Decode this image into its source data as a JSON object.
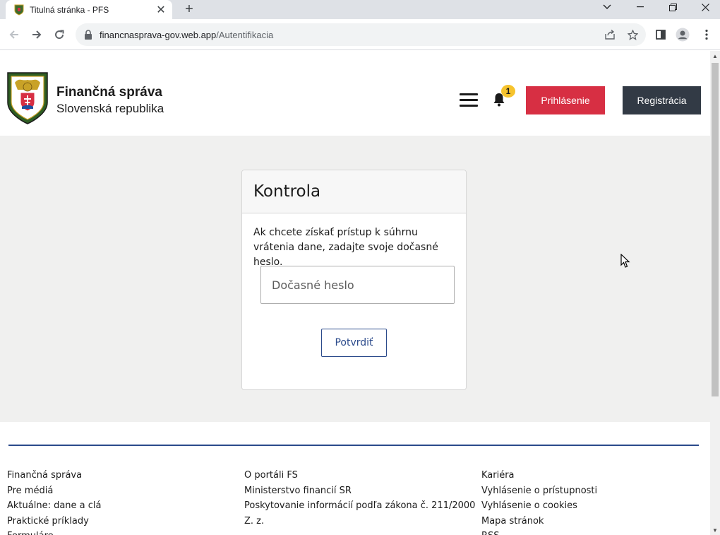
{
  "browser": {
    "tab_title": "Titulná stránka - PFS",
    "url_host": "financnasprava-gov.web.app",
    "url_path": "/Autentifikacia"
  },
  "header": {
    "brand_title": "Finančná správa",
    "brand_subtitle": "Slovenská republika",
    "crest_text": "FINANČNÁ SPRÁVA · SLOVENSKÁ REPUBLIKA",
    "notification_count": "1",
    "login_label": "Prihlásenie",
    "register_label": "Registrácia"
  },
  "card": {
    "title": "Kontrola",
    "description": "Ak chcete získať prístup k súhrnu vrátenia dane, zadajte svoje dočasné heslo.",
    "password_placeholder": "Dočasné heslo",
    "confirm_label": "Potvrdiť"
  },
  "footer": {
    "col1": [
      "Finančná správa",
      "Pre médiá",
      "Aktuálne: dane a clá",
      "Praktické príklady",
      "Formuláre"
    ],
    "col2": [
      "O portáli FS",
      "Ministerstvo financií SR",
      "Poskytovanie informácií podľa zákona č. 211/2000",
      "Z. z."
    ],
    "col3": [
      "Kariéra",
      "Vyhlásenie o prístupnosti",
      "Vyhlásenie o cookies",
      "Mapa stránok",
      "RSS"
    ]
  },
  "colors": {
    "login_button": "#d72f43",
    "register_button": "#323a45",
    "accent_blue": "#2b4a8b",
    "badge_yellow": "#f6c32d",
    "page_background": "#f0f0ef"
  }
}
